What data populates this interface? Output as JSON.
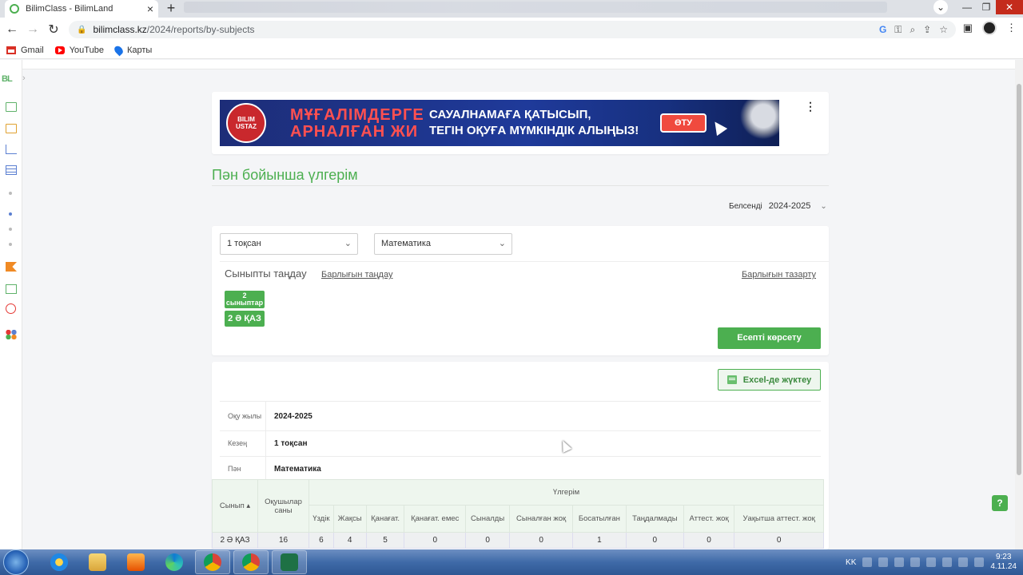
{
  "browser": {
    "tab_title": "BilimClass - BilimLand",
    "new_tab_glyph": "+",
    "url_host": "bilimclass.kz",
    "url_path": "/2024/reports/by-subjects",
    "bookmarks": [
      {
        "label": "Gmail",
        "icon": "gmail-icon"
      },
      {
        "label": "YouTube",
        "icon": "youtube-icon"
      },
      {
        "label": "Карты",
        "icon": "maps-icon"
      }
    ]
  },
  "sidebar": {
    "logo": "BL"
  },
  "banner": {
    "seal_text": "BILIM USTAZ",
    "left_line1": "МҰҒАЛІМДЕРГЕ",
    "left_line2": "АРНАЛҒАН ЖИ",
    "right_line1": "САУАЛНАМАҒА ҚАТЫСЫП,",
    "right_line2": "ТЕГІН ОҚУҒА МҮМКІНДІК АЛЫҢЫЗ!",
    "button": "ӨТУ"
  },
  "page": {
    "title": "Пән бойынша үлгерім",
    "active_label": "Белсенді",
    "active_year": "2024-2025"
  },
  "filters": {
    "period": "1 тоқсан",
    "subject": "Математика",
    "class_select_label": "Сыныпты таңдау",
    "select_all": "Барлығын таңдау",
    "clear_all": "Барлығын тазарту",
    "grade_chip_line1": "2",
    "grade_chip_line2": "сыныптар",
    "class_chip": "2 Ә ҚАЗ",
    "show_report": "Есепті көрсету"
  },
  "report": {
    "excel_button": "Excel-де жүктеу",
    "meta": [
      {
        "key": "Оқу жылы",
        "value": "2024-2025"
      },
      {
        "key": "Кезең",
        "value": "1 тоқсан"
      },
      {
        "key": "Пән",
        "value": "Математика"
      }
    ],
    "table": {
      "col_class": "Сынып",
      "col_students": "Оқушылар саны",
      "col_group": "Үлгерім",
      "subcols": [
        "Үздік",
        "Жақсы",
        "Қанағат.",
        "Қанағат. емес",
        "Сыналды",
        "Сыналған жоқ",
        "Босатылған",
        "Таңдалмады",
        "Аттест. жоқ",
        "Уақытша аттест. жоқ"
      ],
      "rows": [
        {
          "class": "2 Ә ҚАЗ",
          "students": "16",
          "cells": [
            "6",
            "4",
            "5",
            "0",
            "0",
            "0",
            "1",
            "0",
            "0",
            "0"
          ]
        }
      ]
    }
  },
  "taskbar": {
    "lang": "KK",
    "time": "9:23",
    "date": "4.11.24"
  }
}
